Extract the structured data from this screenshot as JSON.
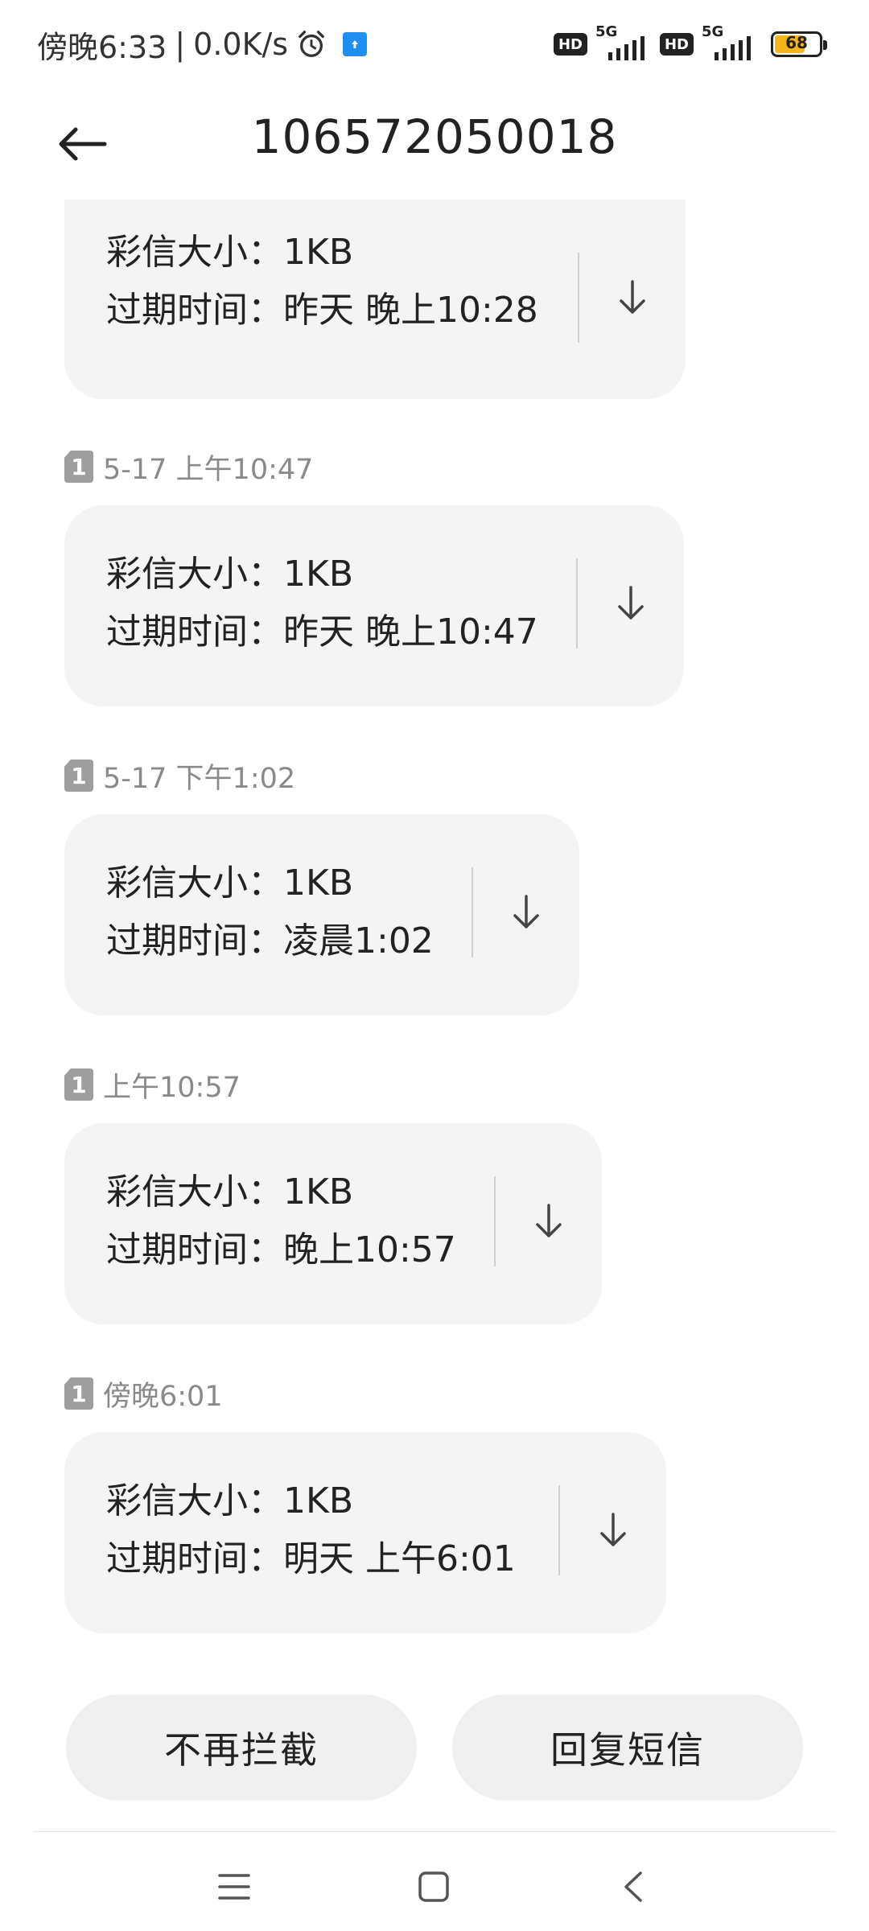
{
  "status_bar": {
    "time": "傍晚6:33",
    "network_speed": "0.0K/s",
    "hd_label": "HD",
    "net_type": "5G",
    "battery": "68",
    "battery_level": 0.68
  },
  "header": {
    "title": "106572050018"
  },
  "messages": [
    {
      "time": "",
      "sim": "1",
      "size_label": "彩信大小：",
      "size": "1KB",
      "expire_label": "过期时间：",
      "expire": "昨天 晚上10:28"
    },
    {
      "time": "5-17 上午10:47",
      "sim": "1",
      "size_label": "彩信大小：",
      "size": "1KB",
      "expire_label": "过期时间：",
      "expire": "昨天 晚上10:47"
    },
    {
      "time": "5-17 下午1:02",
      "sim": "1",
      "size_label": "彩信大小：",
      "size": "1KB",
      "expire_label": "过期时间：",
      "expire": "凌晨1:02"
    },
    {
      "time": "上午10:57",
      "sim": "1",
      "size_label": "彩信大小：",
      "size": "1KB",
      "expire_label": "过期时间：",
      "expire": "晚上10:57"
    },
    {
      "time": "傍晚6:01",
      "sim": "1",
      "size_label": "彩信大小：",
      "size": "1KB",
      "expire_label": "过期时间：",
      "expire": "明天 上午6:01"
    }
  ],
  "actions": {
    "unblock_label": "不再拦截",
    "reply_label": "回复短信"
  },
  "icons": {
    "back": "arrow-left-icon",
    "download": "arrow-down-icon",
    "menu": "menu-icon",
    "home": "home-icon",
    "nav_back": "chevron-left-icon"
  }
}
